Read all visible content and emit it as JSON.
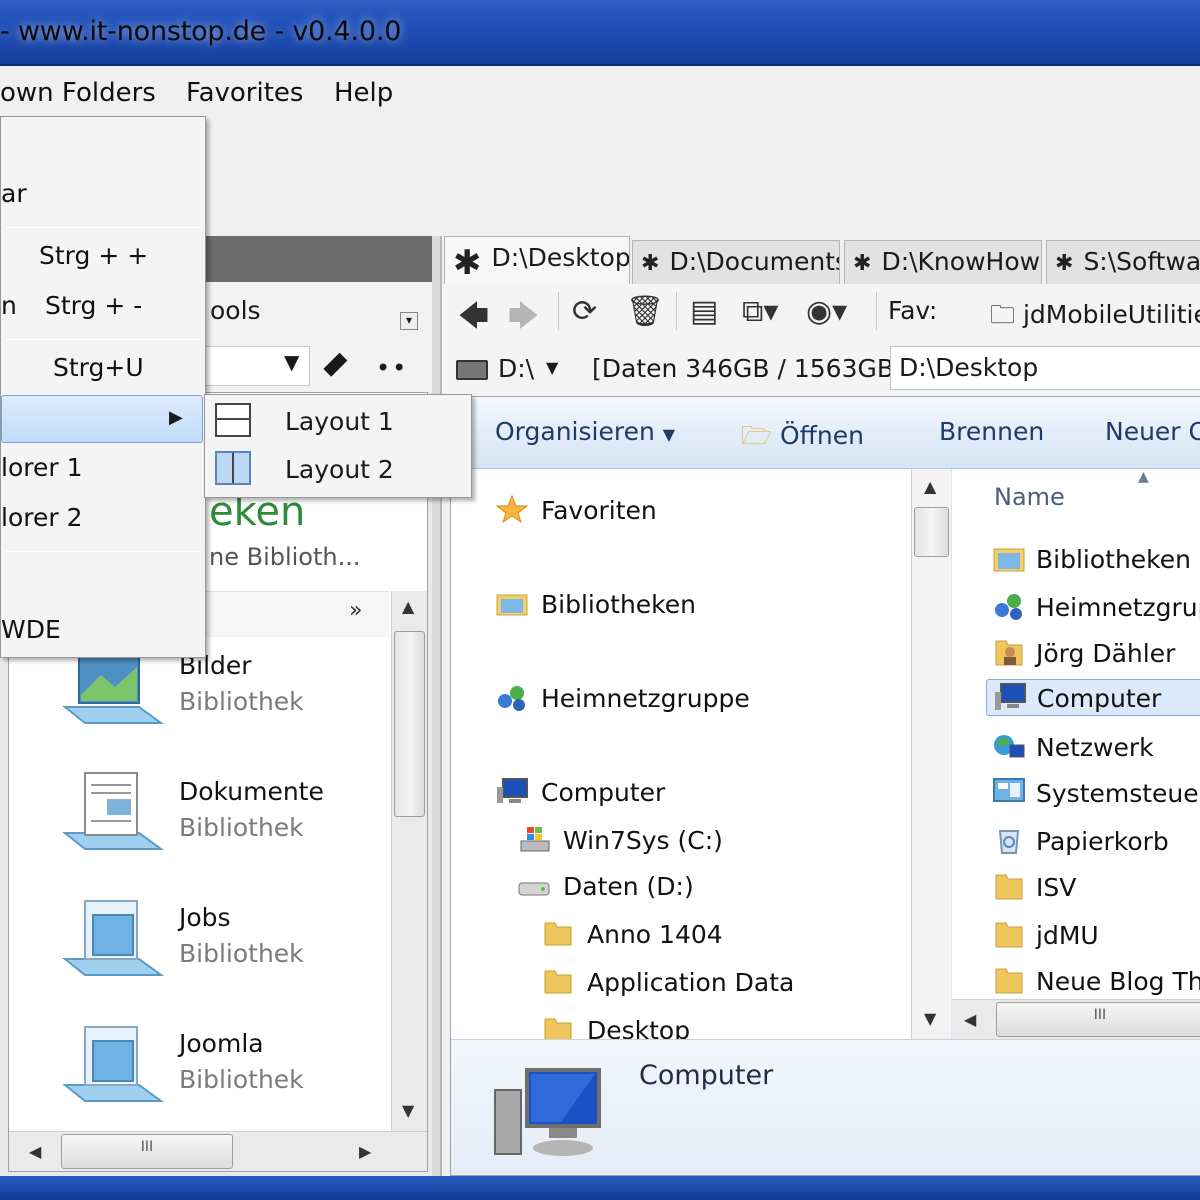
{
  "window": {
    "title": "- www.it-nonstop.de - v0.4.0.0"
  },
  "menubar": {
    "items": [
      "own Folders",
      "Favorites",
      "Help"
    ]
  },
  "popup_menu": {
    "items": [
      {
        "label": "ar",
        "shortcut": ""
      },
      {
        "label": "",
        "shortcut": "Strg + +"
      },
      {
        "label": "n",
        "shortcut": "Strg + -"
      },
      {
        "label": "",
        "shortcut": "Strg+U"
      },
      {
        "label": "lorer 1",
        "shortcut": ""
      },
      {
        "label": "lorer 2",
        "shortcut": ""
      },
      {
        "label": "WDE",
        "shortcut": ""
      }
    ]
  },
  "submenu": {
    "items": [
      "Layout 1",
      "Layout 2"
    ]
  },
  "left_pane": {
    "tools_label": "ools",
    "library_title": "eken",
    "library_subtitle": "ne Biblioth...",
    "chevron": "»",
    "libraries": [
      {
        "name": "Bilder",
        "kind": "Bibliothek"
      },
      {
        "name": "Dokumente",
        "kind": "Bibliothek"
      },
      {
        "name": "Jobs",
        "kind": "Bibliothek"
      },
      {
        "name": "Joomla",
        "kind": "Bibliothek"
      }
    ]
  },
  "right_pane": {
    "tabs": [
      "D:\\Desktop",
      "D:\\Documents",
      "D:\\KnowHow",
      "S:\\Softwar"
    ],
    "fav_label": "Fav:",
    "fav_value": "jdMobileUtilities",
    "drive": "D:\\",
    "drive_info": "[Daten 346GB / 1563GB]",
    "path": "D:\\Desktop",
    "commands": [
      "Organisieren",
      "Öffnen",
      "Brennen",
      "Neuer O"
    ],
    "nav": [
      {
        "label": "Favoriten",
        "icon": "star-icon"
      },
      {
        "label": "Bibliotheken",
        "icon": "libraries-icon"
      },
      {
        "label": "Heimnetzgruppe",
        "icon": "homegroup-icon"
      },
      {
        "label": "Computer",
        "icon": "computer-icon"
      },
      {
        "label": "Win7Sys (C:)",
        "icon": "windows-drive-icon"
      },
      {
        "label": "Daten (D:)",
        "icon": "drive-icon"
      },
      {
        "label": "Anno 1404",
        "icon": "folder-icon"
      },
      {
        "label": "Application Data",
        "icon": "folder-icon"
      },
      {
        "label": "Desktop",
        "icon": "folder-icon"
      }
    ],
    "column_header": "Name",
    "files": [
      {
        "label": "Bibliotheken",
        "icon": "libraries-icon"
      },
      {
        "label": "Heimnetzgrup",
        "icon": "homegroup-icon"
      },
      {
        "label": "Jörg Dähler",
        "icon": "user-folder-icon"
      },
      {
        "label": "Computer",
        "icon": "computer-icon"
      },
      {
        "label": "Netzwerk",
        "icon": "network-icon"
      },
      {
        "label": "Systemsteuer",
        "icon": "control-panel-icon"
      },
      {
        "label": "Papierkorb",
        "icon": "recycle-bin-icon"
      },
      {
        "label": "ISV",
        "icon": "folder-icon"
      },
      {
        "label": "jdMU",
        "icon": "folder-icon"
      },
      {
        "label": "Neue Blog Th",
        "icon": "folder-icon"
      }
    ],
    "details_name": "Computer",
    "scroll_grip": "III"
  },
  "colors": {
    "titlebar": "#1f4fb8",
    "selection": "#dbe9fa",
    "library_title": "#2e8b3a",
    "command_text": "#1e3b66"
  }
}
